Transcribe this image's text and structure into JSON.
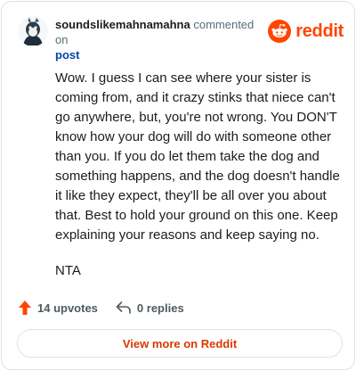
{
  "comment": {
    "username": "soundslikemahnamahna",
    "action_text": "commented on",
    "target_link": "post",
    "paragraphs": [
      "Wow. I guess I can see where your sister is coming from, and it crazy stinks that niece can't go anywhere, but, you're not wrong. You DON'T know how your dog will do with someone other than you. If you do let them take the dog and something happens, and the dog doesn't handle it like they expect, they'll be all over you about that. Best to hold your ground on this one. Keep explaining your reasons and keep saying no.",
      "NTA"
    ],
    "upvotes": "14 upvotes",
    "replies": "0 replies"
  },
  "brand": {
    "name": "reddit",
    "icon": "reddit-logo-icon",
    "color": "#ff4500"
  },
  "footer": {
    "view_more": "View more on Reddit"
  },
  "colors": {
    "upvote": "#ff4500",
    "link": "#0045ac",
    "button_text": "#d93900"
  }
}
